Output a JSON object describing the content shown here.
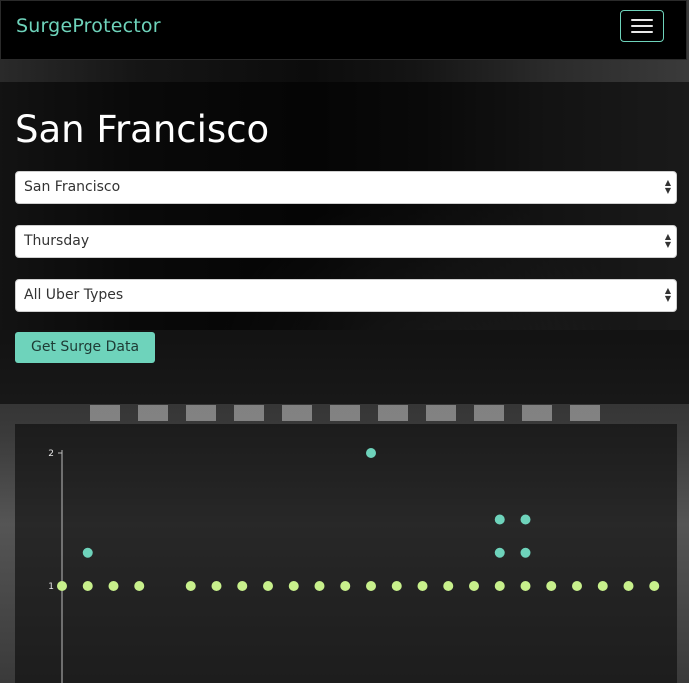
{
  "brand": "SurgeProtector",
  "title": "San Francisco",
  "selects": {
    "city": "San Francisco",
    "day": "Thursday",
    "uber_type": "All Uber Types"
  },
  "button_label": "Get Surge Data",
  "colors": {
    "accent": "#6ed3bb",
    "point_base": "#c8f08c",
    "point_surge": "#6ed3bb"
  },
  "chart_data": {
    "type": "scatter",
    "ylim": [
      1,
      2
    ],
    "y_ticks": [
      "1",
      "2"
    ],
    "x": [
      1,
      2,
      3,
      4,
      6,
      7,
      8,
      9,
      10,
      11,
      12,
      13,
      14,
      15,
      16,
      17,
      18,
      19,
      20,
      21,
      22,
      23,
      24,
      2,
      13,
      18,
      19,
      18,
      19
    ],
    "y": [
      1,
      1,
      1,
      1,
      1,
      1,
      1,
      1,
      1,
      1,
      1,
      1,
      1,
      1,
      1,
      1,
      1,
      1,
      1,
      1,
      1,
      1,
      1,
      1.25,
      2,
      1.25,
      1.25,
      1.5,
      1.5
    ],
    "series_kind": [
      "base",
      "base",
      "base",
      "base",
      "base",
      "base",
      "base",
      "base",
      "base",
      "base",
      "base",
      "base",
      "base",
      "base",
      "base",
      "base",
      "base",
      "base",
      "base",
      "base",
      "base",
      "base",
      "base",
      "surge",
      "surge",
      "surge",
      "surge",
      "surge",
      "surge"
    ]
  }
}
